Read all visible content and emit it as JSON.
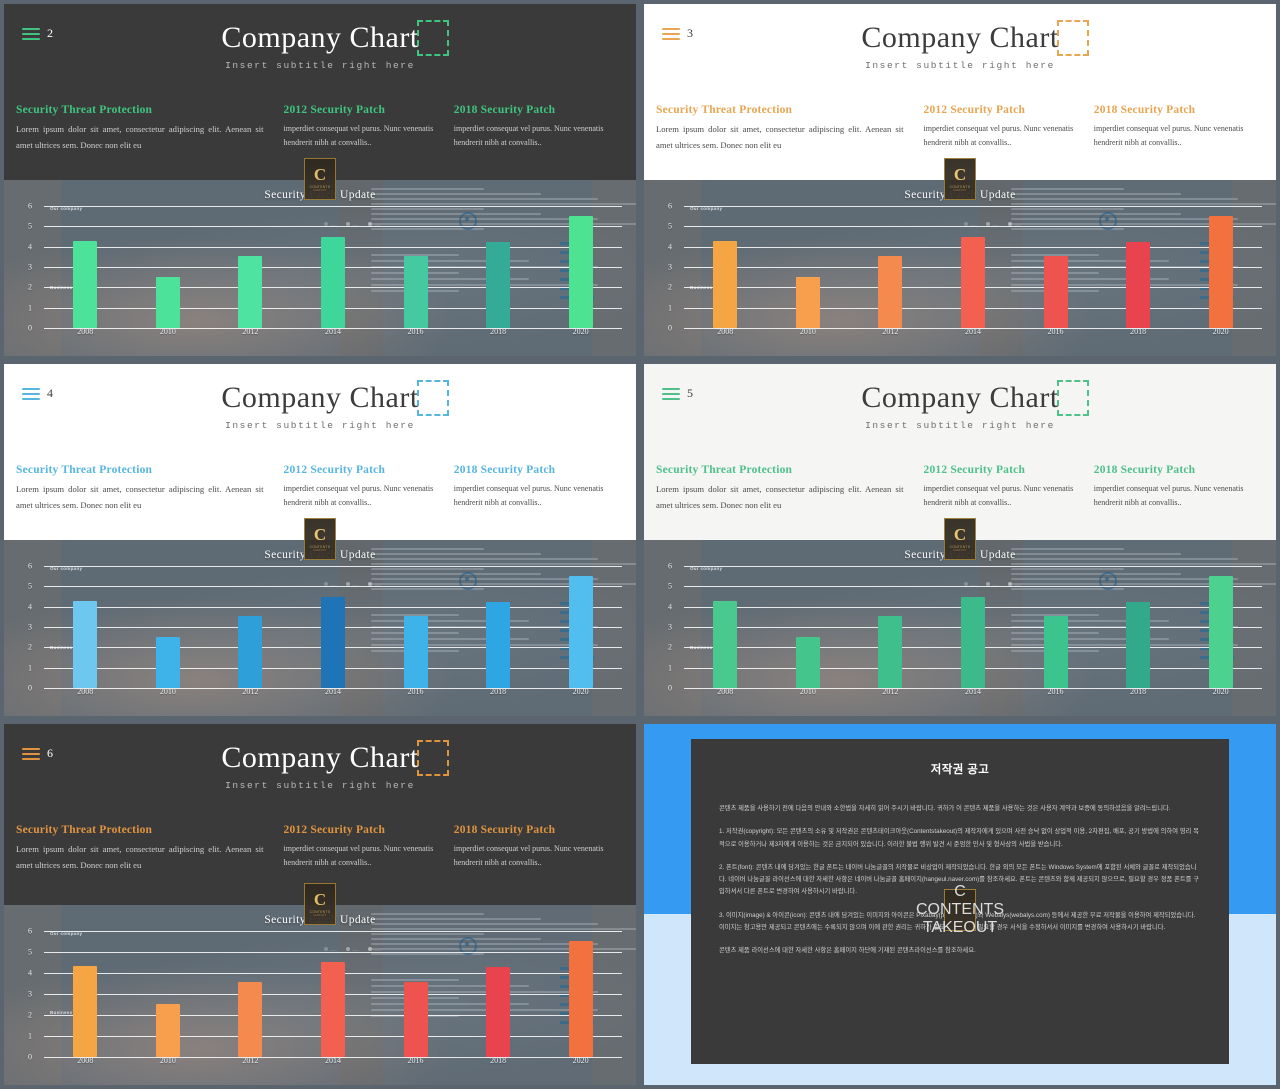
{
  "slides": [
    {
      "page": "2",
      "theme": "dark",
      "accent": "#3fc57f",
      "bg": "#3a3a3a",
      "title_color": "#ffffff",
      "body_color": "#cfcfcf",
      "title": "Company Chart",
      "subtitle": "Insert subtitle right here",
      "col1_head": "Security Threat Protection",
      "col1_body": "Lorem ipsum dolor sit amet, consectetur adipiscing elit. Aenean sit amet ultrices sem. Donec non elit eu",
      "col2_head": "2012  Security Patch",
      "col2_body": "imperdiet consequat vel purus. Nunc venenatis hendrerit nibh at convallis..",
      "col3_head": "2018  Security Patch",
      "col3_body": "imperdiet consequat vel purus. Nunc venenatis hendrerit nibh at convallis..",
      "chart_title": "Security Patch Update",
      "bar_colors": [
        "#4de29a",
        "#4de29a",
        "#4ee3a0",
        "#3fd69c",
        "#45c9a0",
        "#33ab96",
        "#4de392"
      ]
    },
    {
      "page": "3",
      "theme": "light",
      "accent": "#e8a552",
      "bg": "#ffffff",
      "title_color": "#3c3c3c",
      "body_color": "#4a4a4a",
      "title": "Company Chart",
      "subtitle": "Insert subtitle right here",
      "col1_head": "Security Threat Protection",
      "col1_body": "Lorem ipsum dolor sit amet, consectetur adipiscing elit. Aenean sit amet ultrices sem. Donec non elit eu",
      "col2_head": "2012  Security Patch",
      "col2_body": "imperdiet consequat vel purus. Nunc venenatis hendrerit nibh at convallis..",
      "col3_head": "2018  Security Patch",
      "col3_body": "imperdiet consequat vel purus. Nunc venenatis hendrerit nibh at convallis..",
      "chart_title": "Security Patch Update",
      "bar_colors": [
        "#f6a545",
        "#f79f4c",
        "#f58a4e",
        "#f4604f",
        "#ef5350",
        "#e8434f",
        "#f2713f"
      ]
    },
    {
      "page": "4",
      "theme": "light",
      "accent": "#57b6e0",
      "bg": "#ffffff",
      "title_color": "#3c3c3c",
      "body_color": "#4a4a4a",
      "title": "Company Chart",
      "subtitle": "Insert subtitle right here",
      "col1_head": "Security Threat Protection",
      "col1_body": "Lorem ipsum dolor sit amet, consectetur adipiscing elit. Aenean sit amet ultrices sem. Donec non elit eu",
      "col2_head": "2012  Security Patch",
      "col2_body": "imperdiet consequat vel purus. Nunc venenatis hendrerit nibh at convallis..",
      "col3_head": "2018  Security Patch",
      "col3_body": "imperdiet consequat vel purus. Nunc venenatis hendrerit nibh at convallis..",
      "chart_title": "Security Patch Update",
      "bar_colors": [
        "#6ec7ee",
        "#3db3ea",
        "#2e9fd9",
        "#1f74b8",
        "#3db3ea",
        "#2fa6e4",
        "#52bdef"
      ]
    },
    {
      "page": "5",
      "theme": "light",
      "accent": "#4ec08a",
      "bg": "#f5f5f3",
      "title_color": "#3c3c3c",
      "body_color": "#4a4a4a",
      "title": "Company Chart",
      "subtitle": "Insert subtitle right here",
      "col1_head": "Security Threat Protection",
      "col1_body": "Lorem ipsum dolor sit amet, consectetur adipiscing elit. Aenean sit amet ultrices sem. Donec non elit eu",
      "col2_head": "2012  Security Patch",
      "col2_body": "imperdiet consequat vel purus. Nunc venenatis hendrerit nibh at convallis..",
      "col3_head": "2018  Security Patch",
      "col3_body": "imperdiet consequat vel purus. Nunc venenatis hendrerit nibh at convallis..",
      "chart_title": "Security Patch Update",
      "bar_colors": [
        "#49c98d",
        "#43c58c",
        "#3fbf8c",
        "#3dba8b",
        "#3cc48f",
        "#33a98b",
        "#4dd18f"
      ]
    },
    {
      "page": "6",
      "theme": "dark",
      "accent": "#e09440",
      "bg": "#3a3a3a",
      "title_color": "#ffffff",
      "body_color": "#cfcfcf",
      "title": "Company Chart",
      "subtitle": "Insert subtitle right here",
      "col1_head": "Security Threat Protection",
      "col1_body": "Lorem ipsum dolor sit amet, consectetur adipiscing elit. Aenean sit amet ultrices sem. Donec non elit eu",
      "col2_head": "2012  Security Patch",
      "col2_body": "imperdiet consequat vel purus. Nunc venenatis hendrerit nibh at convallis..",
      "col3_head": "2018  Security Patch",
      "col3_body": "imperdiet consequat vel purus. Nunc venenatis hendrerit nibh at convallis..",
      "chart_title": "Security Patch Update",
      "bar_colors": [
        "#f6a545",
        "#f79f4c",
        "#f58a4e",
        "#f4604f",
        "#ef5350",
        "#e8434f",
        "#f2713f"
      ]
    }
  ],
  "chart_data": {
    "type": "bar",
    "title": "Security Patch Update",
    "categories": [
      "2008",
      "2010",
      "2012",
      "2014",
      "2016",
      "2018",
      "2020"
    ],
    "values": [
      4.3,
      2.5,
      3.55,
      4.5,
      3.55,
      4.25,
      5.5
    ],
    "ylim": [
      0,
      6
    ],
    "yticks": [
      "0",
      "1",
      "2",
      "3",
      "4",
      "5",
      "6"
    ],
    "xlabel": "",
    "ylabel": "",
    "grid": true,
    "legend": false,
    "series_label_top": "Our company",
    "series_label_bottom": "Business"
  },
  "badge": {
    "letter": "C",
    "line1": "CONTENTS",
    "line2": "TAKEOUT"
  },
  "copyright": {
    "title": "저작권 공고",
    "intro": "콘텐츠 제품을 사용하기 전에 다음의 안내와 소한법을 자세히 읽어 주시기 바랍니다. 귀하가 이 콘텐츠 제품을 사용하는 것은 사용자 계약과 보증에 동의하셨음을 알려느립니다.",
    "s1": "1. 저작권(copyright): 모든 콘텐츠의 소유 및 저작권은 콘텐츠테이크아웃(Contentstakeout)의 제작자에게 있으며 사전 승낙 없이 상업적 이용, 2차편집, 배포, 공기 방법에 의하여 영리 목적으로 이용하거나 제3자에게 이용하는 것은 금지되어 있습니다. 이러한 불법 행위 발견 시 준엄한 민사 및 형사상의 사법을 받습니다.",
    "s2": "2. 폰트(font): 콘텐츠 내에 담겨있는 한글 폰트는 네이버 나눔글꼴의 저작물로 비상업이 제작되었습니다. 한글 외의 모든 폰트는 Windows System에 포함된 서체와 글꼴로 제작되었습니다. 네이버 나눔글꼴 라이선스에 대한 자세한 사항은 네이버 나눔글꼴 홈페이지(hangeul.naver.com)를 참조하세요. 폰트는 콘텐츠와 함께 제공되지 않으므로, 필요할 경우 정품 폰트를 구입하셔서 다른 폰트로 변경하여 사용하시기 바랍니다.",
    "s3": "3. 이미지(image) & 아이콘(icon): 콘텐츠 내에 담겨있는 이미지와 아이콘은 Pixabay(pixabay.com)와 Webalys(webalys.com) 등에서 제공한 무료 저작물을 이용하여 제작되었습니다. 이미지는 참고용만 제공되고 콘텐츠에는 수록되지 않으며 이에 관한 권리는 귀하가 별도로 확인하고 필요할 경우 서식을 수정하셔서 이미지를 변경하여 사용하시기 바랍니다.",
    "outro": "콘텐츠 제품 라이선스에 대한 자세한 사항은 홈페이지 하단에 기재된 콘텐츠라이선스를 참조하세요."
  }
}
